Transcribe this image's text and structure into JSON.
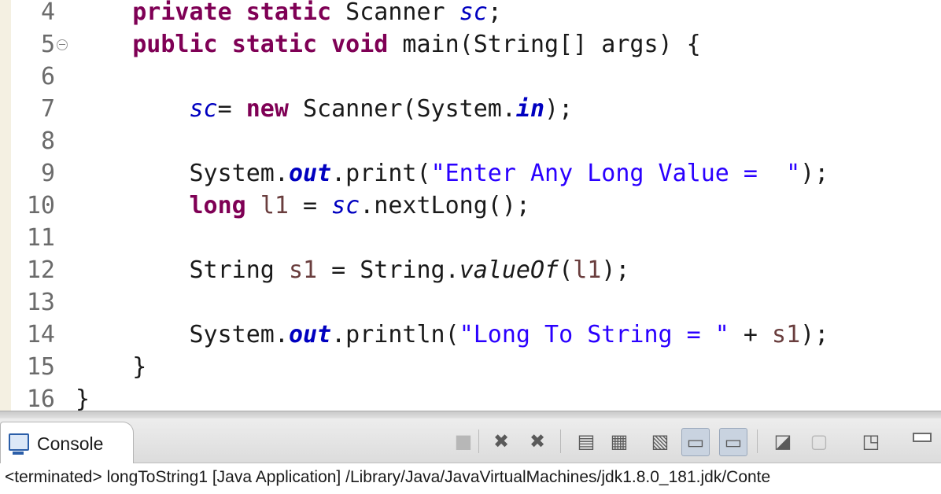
{
  "editor": {
    "lines": [
      {
        "no": "4",
        "tokens": [
          {
            "t": "    ",
            "c": "plain"
          },
          {
            "t": "private",
            "c": "kw"
          },
          {
            "t": " ",
            "c": "plain"
          },
          {
            "t": "static",
            "c": "kw"
          },
          {
            "t": " Scanner ",
            "c": "plain"
          },
          {
            "t": "sc",
            "c": "fld"
          },
          {
            "t": ";",
            "c": "plain"
          }
        ]
      },
      {
        "no": "5",
        "fold": true,
        "tokens": [
          {
            "t": "    ",
            "c": "plain"
          },
          {
            "t": "public",
            "c": "kw"
          },
          {
            "t": " ",
            "c": "plain"
          },
          {
            "t": "static",
            "c": "kw"
          },
          {
            "t": " ",
            "c": "plain"
          },
          {
            "t": "void",
            "c": "kw"
          },
          {
            "t": " main(String[] args) {",
            "c": "plain"
          }
        ]
      },
      {
        "no": "6",
        "tokens": []
      },
      {
        "no": "7",
        "tokens": [
          {
            "t": "        ",
            "c": "plain"
          },
          {
            "t": "sc",
            "c": "fld"
          },
          {
            "t": "= ",
            "c": "plain"
          },
          {
            "t": "new",
            "c": "kw"
          },
          {
            "t": " Scanner(System.",
            "c": "plain"
          },
          {
            "t": "in",
            "c": "sfld"
          },
          {
            "t": ");",
            "c": "plain"
          }
        ]
      },
      {
        "no": "8",
        "tokens": []
      },
      {
        "no": "9",
        "tokens": [
          {
            "t": "        System.",
            "c": "plain"
          },
          {
            "t": "out",
            "c": "sfld"
          },
          {
            "t": ".print(",
            "c": "plain"
          },
          {
            "t": "\"Enter Any Long Value =  \"",
            "c": "str"
          },
          {
            "t": ");",
            "c": "plain"
          }
        ]
      },
      {
        "no": "10",
        "tokens": [
          {
            "t": "        ",
            "c": "plain"
          },
          {
            "t": "long",
            "c": "kw"
          },
          {
            "t": " ",
            "c": "plain"
          },
          {
            "t": "l1",
            "c": "var"
          },
          {
            "t": " = ",
            "c": "plain"
          },
          {
            "t": "sc",
            "c": "fld"
          },
          {
            "t": ".nextLong();",
            "c": "plain"
          }
        ]
      },
      {
        "no": "11",
        "tokens": []
      },
      {
        "no": "12",
        "tokens": [
          {
            "t": "        String ",
            "c": "plain"
          },
          {
            "t": "s1",
            "c": "var"
          },
          {
            "t": " = String.",
            "c": "plain"
          },
          {
            "t": "valueOf",
            "c": "mth"
          },
          {
            "t": "(",
            "c": "plain"
          },
          {
            "t": "l1",
            "c": "var"
          },
          {
            "t": ");",
            "c": "plain"
          }
        ]
      },
      {
        "no": "13",
        "tokens": []
      },
      {
        "no": "14",
        "tokens": [
          {
            "t": "        System.",
            "c": "plain"
          },
          {
            "t": "out",
            "c": "sfld"
          },
          {
            "t": ".println(",
            "c": "plain"
          },
          {
            "t": "\"Long To String = \"",
            "c": "str"
          },
          {
            "t": " + ",
            "c": "plain"
          },
          {
            "t": "s1",
            "c": "var"
          },
          {
            "t": ");",
            "c": "plain"
          }
        ]
      },
      {
        "no": "15",
        "tokens": [
          {
            "t": "    }",
            "c": "plain"
          }
        ]
      },
      {
        "no": "16",
        "tokens": [
          {
            "t": "}",
            "c": "plain"
          }
        ]
      }
    ]
  },
  "console": {
    "tab_label": "Console",
    "status_text": "<terminated> longToString1 [Java Application] /Library/Java/JavaVirtualMachines/jdk1.8.0_181.jdk/Conte",
    "toolbar": [
      {
        "name": "terminate-icon",
        "glyph": "■",
        "disabled": true
      },
      {
        "name": "remove-launch-icon",
        "glyph": "✖"
      },
      {
        "name": "remove-all-terminated-icon",
        "glyph": "✖"
      },
      {
        "name": "clear-console-icon",
        "glyph": "▤"
      },
      {
        "name": "scroll-lock-icon",
        "glyph": "▦"
      },
      {
        "name": "word-wrap-icon",
        "glyph": "▧"
      },
      {
        "name": "show-on-stdout-icon",
        "glyph": "▭",
        "pressed": true
      },
      {
        "name": "show-on-stderr-icon",
        "glyph": "▭",
        "pressed": true
      },
      {
        "name": "pin-console-icon",
        "glyph": "◪"
      },
      {
        "name": "display-console-icon",
        "glyph": "▢",
        "disabled": true
      },
      {
        "name": "open-console-icon",
        "glyph": "◳"
      }
    ]
  }
}
